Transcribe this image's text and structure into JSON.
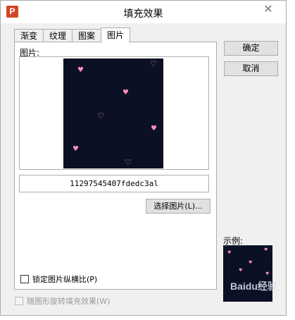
{
  "window": {
    "title": "填充效果",
    "app_icon_text": "P",
    "close_symbol": "✕"
  },
  "tabs": [
    {
      "label": "渐变"
    },
    {
      "label": "纹理"
    },
    {
      "label": "图案"
    },
    {
      "label": "图片"
    }
  ],
  "picture_panel": {
    "picture_label": "图片:",
    "file_name": "11297545407fdedc3al",
    "select_button_label": "选择图片(L)...",
    "lock_aspect_label": "锁定图片纵横比(P)",
    "lock_aspect_checked": false
  },
  "rotate_with_shape": {
    "label": "随图形旋转填充效果(W)",
    "checked": false,
    "enabled": false
  },
  "buttons": {
    "ok_label": "确定",
    "cancel_label": "取消"
  },
  "example": {
    "label": "示例:",
    "watermark": "Baidu经验"
  },
  "colors": {
    "image_background": "#0c1024",
    "heart": "#ff8fb8"
  }
}
